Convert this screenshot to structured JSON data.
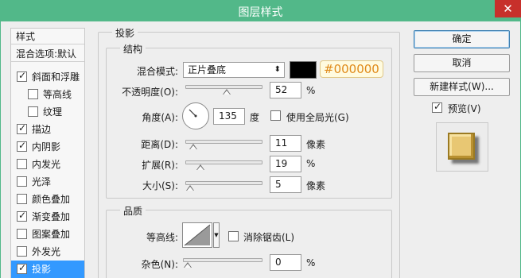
{
  "window": {
    "title": "图层样式",
    "close_glyph": "✕"
  },
  "style_list": {
    "header": "样式",
    "blend_options": "混合选项:默认",
    "items": [
      {
        "label": "斜面和浮雕",
        "checked": true,
        "check": "✓"
      },
      {
        "label": "等高线",
        "checked": false,
        "check": ""
      },
      {
        "label": "纹理",
        "checked": false,
        "check": ""
      },
      {
        "label": "描边",
        "checked": true,
        "check": "✓"
      },
      {
        "label": "内阴影",
        "checked": true,
        "check": "✓"
      },
      {
        "label": "内发光",
        "checked": false,
        "check": ""
      },
      {
        "label": "光泽",
        "checked": false,
        "check": ""
      },
      {
        "label": "颜色叠加",
        "checked": false,
        "check": ""
      },
      {
        "label": "渐变叠加",
        "checked": true,
        "check": "✓"
      },
      {
        "label": "图案叠加",
        "checked": false,
        "check": ""
      },
      {
        "label": "外发光",
        "checked": false,
        "check": ""
      },
      {
        "label": "投影",
        "checked": true,
        "check": "✓",
        "selected": true
      }
    ]
  },
  "drop_shadow": {
    "section_title": "投影",
    "structure": {
      "title": "结构",
      "blend_mode_label": "混合模式:",
      "blend_mode_value": "正片叠底",
      "select_arrow": "⬍",
      "color": "#000000",
      "color_hex_label": "#000000",
      "opacity_label": "不透明度(O):",
      "opacity_value": "52",
      "opacity_unit": "%",
      "angle_label": "角度(A):",
      "angle_value": "135",
      "angle_unit": "度",
      "global_light_label": "使用全局光(G)",
      "distance_label": "距离(D):",
      "distance_value": "11",
      "distance_unit": "像素",
      "spread_label": "扩展(R):",
      "spread_value": "19",
      "spread_unit": "%",
      "size_label": "大小(S):",
      "size_value": "5",
      "size_unit": "像素"
    },
    "quality": {
      "title": "品质",
      "contour_label": "等高线:",
      "anti_alias_label": "消除锯齿(L)",
      "noise_label": "杂色(N):",
      "noise_value": "0",
      "noise_unit": "%"
    }
  },
  "buttons": {
    "ok": "确定",
    "cancel": "取消",
    "new_style": "新建样式(W)...",
    "preview_label": "预览(V)",
    "preview_check": "✓"
  }
}
